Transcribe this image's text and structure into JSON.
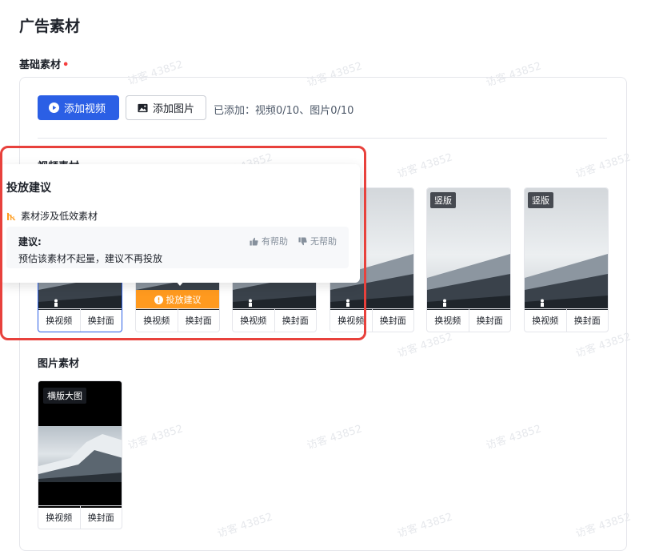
{
  "page_title": "广告素材",
  "basic_section": {
    "title": "基础素材",
    "required_mark": "•"
  },
  "toolbar": {
    "add_video_label": "添加视频",
    "add_image_label": "添加图片",
    "added_text": "已添加：视频0/10、图片0/10"
  },
  "video_section": {
    "title": "视频素材",
    "cards": [
      {
        "tag": "",
        "replace_video": "换视频",
        "replace_cover": "换封面"
      },
      {
        "tag": "",
        "warning": "投放建议",
        "replace_video": "换视频",
        "replace_cover": "换封面"
      },
      {
        "tag": "",
        "replace_video": "换视频",
        "replace_cover": "换封面"
      },
      {
        "tag": "",
        "replace_video": "换视频",
        "replace_cover": "换封面"
      },
      {
        "tag": "竖版",
        "replace_video": "换视频",
        "replace_cover": "换封面"
      },
      {
        "tag": "竖版",
        "replace_video": "换视频",
        "replace_cover": "换封面"
      }
    ]
  },
  "image_section": {
    "title": "图片素材",
    "cards": [
      {
        "tag": "横版大图",
        "replace_video": "换视频",
        "replace_cover": "换封面"
      }
    ]
  },
  "popover": {
    "title": "投放建议",
    "issue": "素材涉及低效素材",
    "advice_label": "建议:",
    "advice_text": "预估该素材不起量，建议不再投放",
    "helpful": "有帮助",
    "not_helpful": "无帮助"
  },
  "watermark": "访客 43852",
  "colors": {
    "primary": "#2b5fe5",
    "warning": "#ff9a1f",
    "highlight": "#e8413c",
    "required": "#f53f3f"
  }
}
